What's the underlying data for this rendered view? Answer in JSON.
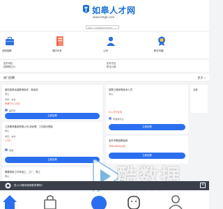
{
  "header": {
    "logo_text": "如皋人才网",
    "logo_url": "www.rrtrgb.com",
    "search_placeholder": "搜索 / 请搜索职位关键字"
  },
  "categories": [
    {
      "label": "全职招聘",
      "icon": "briefcase-icon"
    },
    {
      "label": "简历众多",
      "icon": "resume-icon"
    },
    {
      "label": "公司",
      "icon": "person-icon"
    },
    {
      "label": "职位专题",
      "icon": "badge-icon"
    }
  ],
  "cities": [
    {
      "line1": "如外城区",
      "line2": "招聘职位为"
    },
    {
      "line1": "如外东区",
      "line2": "职位分数"
    }
  ],
  "section": {
    "title": "热门招聘",
    "more": "更多 >"
  },
  "jobs": {
    "card1": {
      "title": "美凯如皋涂装聘请操作、喷涂岗",
      "loc": "南山",
      "edu": "学历：本科",
      "pay": "年薪 5.0-1.5万",
      "company": "美年地",
      "apply": "立即应聘"
    },
    "card2": {
      "title": "江苏教育集团有限公司-总经理、工作部分理经",
      "loc": "南山",
      "edu": "学历：本科",
      "pay": "1.2万",
      "company": "南通",
      "apply": "立即应聘"
    },
    "card3": {
      "title": "需要熟练工作本地工、工厂、熟工",
      "loc": "南山"
    },
    "card4": {
      "title": "招聘工程师等技术人员",
      "sub": "南山",
      "pay": "5-1.2万元/月",
      "company": "南通某外企",
      "apply": "立即应聘"
    },
    "card5": {
      "title": "如外市需招聘技师",
      "sub": "3000-5000元/月",
      "apply": "立即应聘"
    },
    "card6": {
      "title": "业务"
    },
    "urgent": "急"
  },
  "banner": {
    "text": "进入小程序使用更多便利！",
    "close": "×"
  },
  "watermark": {
    "main": "酷数据",
    "sub": "KUIDC"
  }
}
